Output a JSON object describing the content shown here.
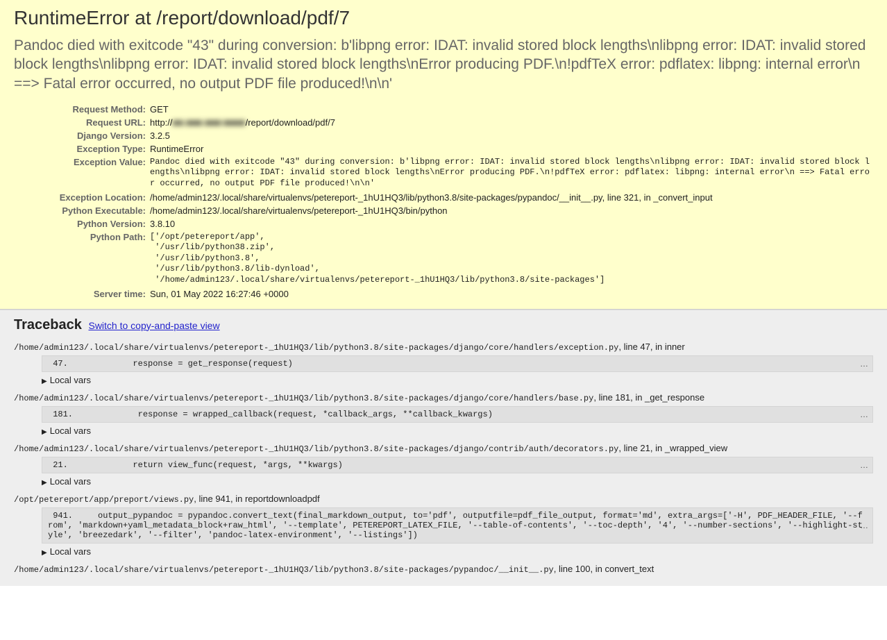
{
  "header": {
    "title_prefix": "RuntimeError at ",
    "title_path": "/report/download/pdf/7",
    "exception_msg": "Pandoc died with exitcode \"43\" during conversion: b'libpng error: IDAT: invalid stored block lengths\\nlibpng error: IDAT: invalid stored block lengths\\nlibpng error: IDAT: invalid stored block lengths\\nError producing PDF.\\n!pdfTeX error: pdflatex: libpng: internal error\\n ==> Fatal error occurred, no output PDF file produced!\\n\\n'"
  },
  "meta": {
    "labels": {
      "request_method": "Request Method:",
      "request_url": "Request URL:",
      "django_version": "Django Version:",
      "exception_type": "Exception Type:",
      "exception_value": "Exception Value:",
      "exception_location": "Exception Location:",
      "python_executable": "Python Executable:",
      "python_version": "Python Version:",
      "python_path": "Python Path:",
      "server_time": "Server time:"
    },
    "request_method": "GET",
    "request_url_prefix": "http://",
    "request_url_hidden": "■■.■■■.■■■:■■■■",
    "request_url_suffix": "/report/download/pdf/7",
    "django_version": "3.2.5",
    "exception_type": "RuntimeError",
    "exception_value": "Pandoc died with exitcode \"43\" during conversion: b'libpng error: IDAT: invalid stored block lengths\\nlibpng error: IDAT: invalid stored block lengths\\nlibpng error: IDAT: invalid stored block lengths\\nError producing PDF.\\n!pdfTeX error: pdflatex: libpng: internal error\\n ==> Fatal error occurred, no output PDF file produced!\\n\\n'",
    "exception_location": "/home/admin123/.local/share/virtualenvs/petereport-_1hU1HQ3/lib/python3.8/site-packages/pypandoc/__init__.py, line 321, in _convert_input",
    "python_executable": "/home/admin123/.local/share/virtualenvs/petereport-_1hU1HQ3/bin/python",
    "python_version": "3.8.10",
    "python_path": "['/opt/petereport/app',\n '/usr/lib/python38.zip',\n '/usr/lib/python3.8',\n '/usr/lib/python3.8/lib-dynload',\n '/home/admin123/.local/share/virtualenvs/petereport-_1hU1HQ3/lib/python3.8/site-packages']",
    "server_time": "Sun, 01 May 2022 16:27:46 +0000"
  },
  "traceback": {
    "heading": "Traceback",
    "switch_label": "Switch to copy-and-paste view",
    "local_vars_label": "Local vars",
    "frames": [
      {
        "path": "/home/admin123/.local/share/virtualenvs/petereport-_1hU1HQ3/lib/python3.8/site-packages/django/core/handlers/exception.py",
        "line_info": ", line 47, in inner",
        "code": " 47.             response = get_response(request)"
      },
      {
        "path": "/home/admin123/.local/share/virtualenvs/petereport-_1hU1HQ3/lib/python3.8/site-packages/django/core/handlers/base.py",
        "line_info": ", line 181, in _get_response",
        "code": " 181.             response = wrapped_callback(request, *callback_args, **callback_kwargs)"
      },
      {
        "path": "/home/admin123/.local/share/virtualenvs/petereport-_1hU1HQ3/lib/python3.8/site-packages/django/contrib/auth/decorators.py",
        "line_info": ", line 21, in _wrapped_view",
        "code": " 21.             return view_func(request, *args, **kwargs)"
      },
      {
        "path": "/opt/petereport/app/preport/views.py",
        "line_info": ", line 941, in reportdownloadpdf",
        "code": " 941.     output_pypandoc = pypandoc.convert_text(final_markdown_output, to='pdf', outputfile=pdf_file_output, format='md', extra_args=['-H', PDF_HEADER_FILE, '--from', 'markdown+yaml_metadata_block+raw_html', '--template', PETEREPORT_LATEX_FILE, '--table-of-contents', '--toc-depth', '4', '--number-sections', '--highlight-style', 'breezedark', '--filter', 'pandoc-latex-environment', '--listings'])"
      },
      {
        "path": "/home/admin123/.local/share/virtualenvs/petereport-_1hU1HQ3/lib/python3.8/site-packages/pypandoc/__init__.py",
        "line_info": ", line 100, in convert_text",
        "code": null
      }
    ]
  }
}
